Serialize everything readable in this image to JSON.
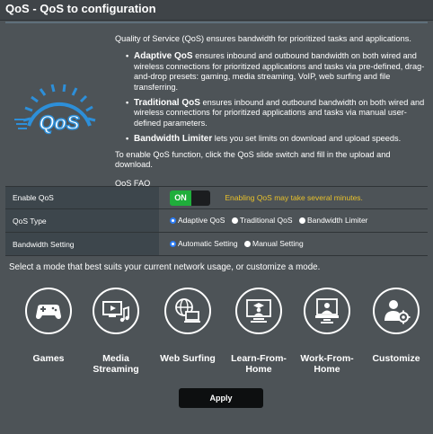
{
  "header": {
    "title": "QoS - QoS to configuration"
  },
  "intro": {
    "description": "Quality of Service (QoS) ensures bandwidth for prioritized tasks and applications.",
    "bullets": [
      {
        "title": "Adaptive QoS",
        "text": "ensures inbound and outbound bandwidth on both wired and wireless connections for prioritized applications and tasks via pre-defined, drag-and-drop presets: gaming, media streaming, VoIP, web surfing and file transferring."
      },
      {
        "title": "Traditional QoS",
        "text": "ensures inbound and outbound bandwidth on both wired and wireless connections for prioritized applications and tasks via manual user-defined parameters."
      },
      {
        "title": "Bandwidth Limiter",
        "text": "lets you set limits on download and upload speeds."
      }
    ],
    "enable_text": "To enable QoS function, click the QoS slide switch and fill in the upload and download.",
    "faq_link": "QoS FAQ"
  },
  "logo": {
    "text": "QoS"
  },
  "settings": {
    "enable_qos": {
      "label": "Enable QoS",
      "toggle_label": "ON",
      "warning": "Enabling QoS may take several minutes."
    },
    "qos_type": {
      "label": "QoS Type",
      "options": [
        "Adaptive QoS",
        "Traditional QoS",
        "Bandwidth Limiter"
      ],
      "selected": "Adaptive QoS"
    },
    "bandwidth_setting": {
      "label": "Bandwidth Setting",
      "options": [
        "Automatic Setting",
        "Manual Setting"
      ],
      "selected": "Automatic Setting"
    }
  },
  "mode_prompt": "Select a mode that best suits your current network usage, or customize a mode.",
  "modes": [
    {
      "label": "Games",
      "icon": "gamepad-icon"
    },
    {
      "label": "Media\nStreaming",
      "icon": "media-streaming-icon"
    },
    {
      "label": "Web Surfing",
      "icon": "web-surfing-icon"
    },
    {
      "label": "Learn-From-\nHome",
      "icon": "learn-from-home-icon"
    },
    {
      "label": "Work-From-\nHome",
      "icon": "work-from-home-icon"
    },
    {
      "label": "Customize",
      "icon": "customize-icon"
    }
  ],
  "apply_label": "Apply",
  "colors": {
    "background": "#4d5357",
    "accent_blue": "#2d8fd9",
    "toggle_green": "#1fae3b",
    "warning_yellow": "#e8c12b"
  }
}
